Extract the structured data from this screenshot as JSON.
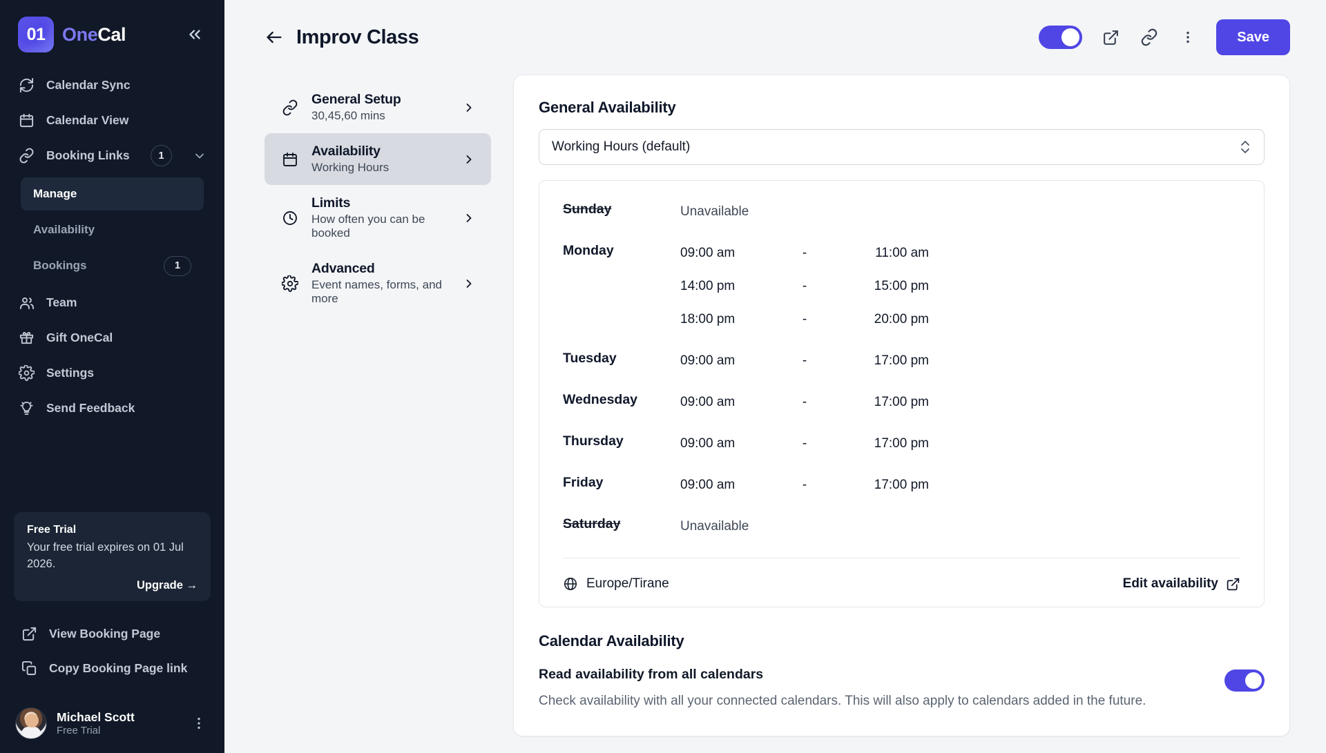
{
  "brand": {
    "logo_mark": "01",
    "name_part1": "One",
    "name_part2": "Cal",
    "collapse_icon": "chevrons-left-icon"
  },
  "sidebar": {
    "nav": [
      {
        "label": "Calendar Sync",
        "icon": "refresh-icon"
      },
      {
        "label": "Calendar View",
        "icon": "calendar-icon"
      },
      {
        "label": "Booking Links",
        "icon": "link-icon",
        "badge": "1",
        "chevron": "chevron-down-icon"
      }
    ],
    "subnav": [
      {
        "label": "Manage",
        "active": true
      },
      {
        "label": "Availability",
        "active": false
      },
      {
        "label": "Bookings",
        "active": false,
        "badge": "1"
      }
    ],
    "nav2": [
      {
        "label": "Team",
        "icon": "team-icon"
      },
      {
        "label": "Gift OneCal",
        "icon": "gift-icon"
      },
      {
        "label": "Settings",
        "icon": "gear-icon"
      },
      {
        "label": "Send Feedback",
        "icon": "lightbulb-icon"
      }
    ],
    "trial": {
      "title": "Free Trial",
      "body": "Your free trial expires on 01 Jul 2026.",
      "upgrade": "Upgrade →"
    },
    "footer": [
      {
        "label": "View Booking Page",
        "icon": "external-link-icon"
      },
      {
        "label": "Copy Booking Page link",
        "icon": "copy-icon"
      }
    ],
    "user": {
      "name": "Michael Scott",
      "plan": "Free Trial",
      "more_icon": "more-vertical-icon"
    }
  },
  "topbar": {
    "back_icon": "arrow-left-icon",
    "title": "Improv Class",
    "toggle_on": true,
    "external_icon": "external-link-icon",
    "link_icon": "link-icon",
    "more_icon": "more-vertical-icon",
    "save_label": "Save"
  },
  "setnav": [
    {
      "title": "General Setup",
      "sub": "30,45,60 mins",
      "icon": "link-icon",
      "active": false
    },
    {
      "title": "Availability",
      "sub": "Working Hours",
      "icon": "calendar-icon",
      "active": true
    },
    {
      "title": "Limits",
      "sub": "How often you can be booked",
      "icon": "clock-icon",
      "active": false
    },
    {
      "title": "Advanced",
      "sub": "Event names, forms, and more",
      "icon": "gear-icon",
      "active": false
    }
  ],
  "general_availability": {
    "section_title": "General Availability",
    "selected_schedule": "Working Hours (default)",
    "unavailable_text": "Unavailable",
    "dash": "-",
    "days": [
      {
        "name": "Sunday",
        "unavailable": true,
        "slots": []
      },
      {
        "name": "Monday",
        "unavailable": false,
        "slots": [
          {
            "start": "09:00 am",
            "end": "11:00 am"
          },
          {
            "start": "14:00 pm",
            "end": "15:00 pm"
          },
          {
            "start": "18:00 pm",
            "end": "20:00 pm"
          }
        ]
      },
      {
        "name": "Tuesday",
        "unavailable": false,
        "slots": [
          {
            "start": "09:00 am",
            "end": "17:00 pm"
          }
        ]
      },
      {
        "name": "Wednesday",
        "unavailable": false,
        "slots": [
          {
            "start": "09:00 am",
            "end": "17:00 pm"
          }
        ]
      },
      {
        "name": "Thursday",
        "unavailable": false,
        "slots": [
          {
            "start": "09:00 am",
            "end": "17:00 pm"
          }
        ]
      },
      {
        "name": "Friday",
        "unavailable": false,
        "slots": [
          {
            "start": "09:00 am",
            "end": "17:00 pm"
          }
        ]
      },
      {
        "name": "Saturday",
        "unavailable": true,
        "slots": []
      }
    ],
    "timezone": "Europe/Tirane",
    "timezone_icon": "globe-icon",
    "edit_link": "Edit availability",
    "edit_link_icon": "external-link-icon"
  },
  "calendar_availability": {
    "section_title": "Calendar Availability",
    "label": "Read availability from all calendars",
    "description": "Check availability with all your connected calendars. This will also apply to calendars added in the future.",
    "toggle_on": true
  },
  "colors": {
    "accent": "#4f46e5",
    "sidebar_bg": "#111827",
    "page_bg": "#f4f5f7",
    "active_nav": "#d7dae0"
  }
}
